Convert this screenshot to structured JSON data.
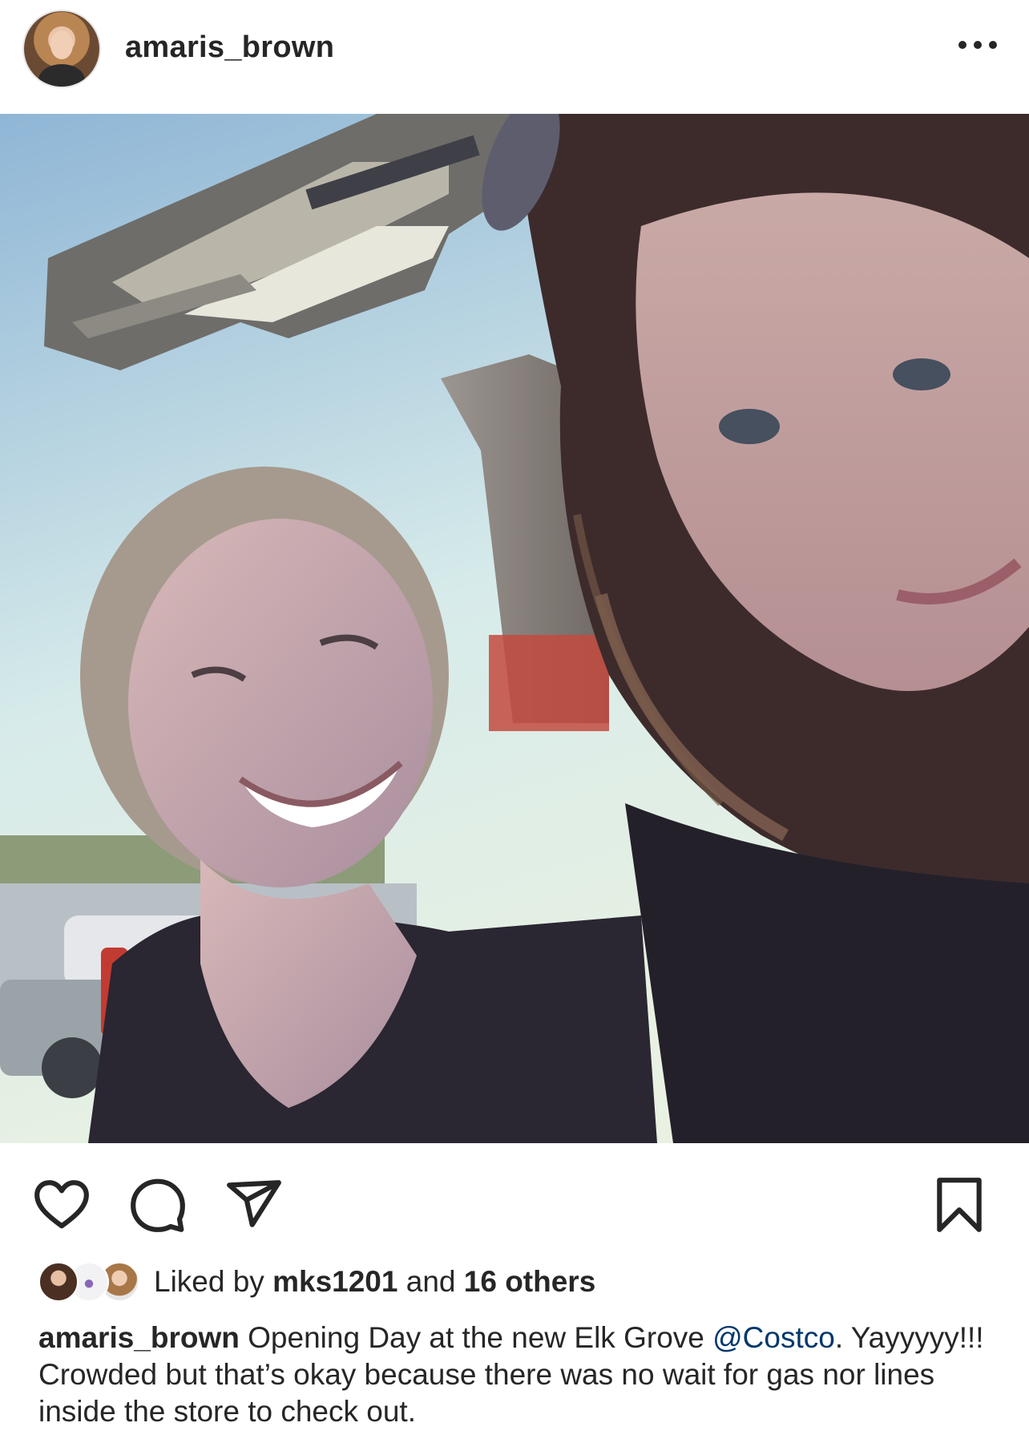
{
  "header": {
    "username": "amaris_brown",
    "avatar_icon": "profile-avatar",
    "more_icon": "more-horizontal-icon"
  },
  "photo": {
    "subject": "selfie"
  },
  "actions": {
    "like_icon": "heart-icon",
    "comment_icon": "comment-bubble-icon",
    "share_icon": "paper-plane-icon",
    "save_icon": "bookmark-icon"
  },
  "likes": {
    "prefix": "Liked by ",
    "user": "mks1201",
    "middle": " and ",
    "others": "16 others"
  },
  "caption": {
    "username": "amaris_brown",
    "text_before": " Opening Day at the new Elk Grove ",
    "mention": "@Costco",
    "text_after": ". Yayyyyy!!! Crowded but that’s okay because there was no wait for gas nor lines inside the store to check out."
  },
  "colors": {
    "text": "#262626",
    "mention": "#00376b",
    "background": "#ffffff"
  }
}
